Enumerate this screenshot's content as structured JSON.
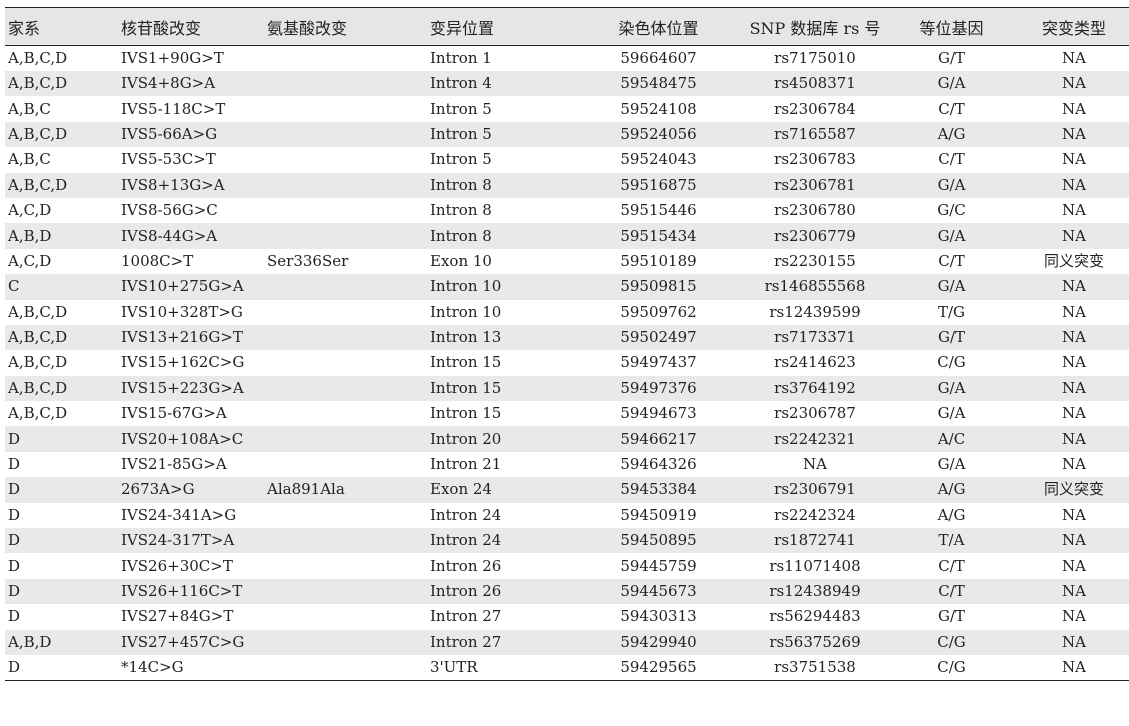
{
  "headers": [
    "家系",
    "核苷酸改变",
    "氨基酸改变",
    "变异位置",
    "染色体位置",
    "SNP 数据库 rs 号",
    "等位基因",
    "突变类型"
  ],
  "rows": [
    [
      "A,B,C,D",
      "IVS1+90G>T",
      "",
      "Intron 1",
      "59664607",
      "rs7175010",
      "G/T",
      "NA"
    ],
    [
      "A,B,C,D",
      "IVS4+8G>A",
      "",
      "Intron 4",
      "59548475",
      "rs4508371",
      "G/A",
      "NA"
    ],
    [
      "A,B,C",
      "IVS5-118C>T",
      "",
      "Intron 5",
      "59524108",
      "rs2306784",
      "C/T",
      "NA"
    ],
    [
      "A,B,C,D",
      "IVS5-66A>G",
      "",
      "Intron 5",
      "59524056",
      "rs7165587",
      "A/G",
      "NA"
    ],
    [
      "A,B,C",
      "IVS5-53C>T",
      "",
      "Intron 5",
      "59524043",
      "rs2306783",
      "C/T",
      "NA"
    ],
    [
      "A,B,C,D",
      "IVS8+13G>A",
      "",
      "Intron 8",
      "59516875",
      "rs2306781",
      "G/A",
      "NA"
    ],
    [
      "A,C,D",
      "IVS8-56G>C",
      "",
      "Intron 8",
      "59515446",
      "rs2306780",
      "G/C",
      "NA"
    ],
    [
      "A,B,D",
      "IVS8-44G>A",
      "",
      "Intron 8",
      "59515434",
      "rs2306779",
      "G/A",
      "NA"
    ],
    [
      "A,C,D",
      "1008C>T",
      "Ser336Ser",
      "Exon 10",
      "59510189",
      "rs2230155",
      "C/T",
      "同义突变"
    ],
    [
      "C",
      "IVS10+275G>A",
      "",
      "Intron 10",
      "59509815",
      "rs146855568",
      "G/A",
      "NA"
    ],
    [
      "A,B,C,D",
      "IVS10+328T>G",
      "",
      "Intron 10",
      "59509762",
      "rs12439599",
      "T/G",
      "NA"
    ],
    [
      "A,B,C,D",
      "IVS13+216G>T",
      "",
      "Intron 13",
      "59502497",
      "rs7173371",
      "G/T",
      "NA"
    ],
    [
      "A,B,C,D",
      "IVS15+162C>G",
      "",
      "Intron 15",
      "59497437",
      "rs2414623",
      "C/G",
      "NA"
    ],
    [
      "A,B,C,D",
      "IVS15+223G>A",
      "",
      "Intron 15",
      "59497376",
      "rs3764192",
      "G/A",
      "NA"
    ],
    [
      "A,B,C,D",
      "IVS15-67G>A",
      "",
      "Intron 15",
      "59494673",
      "rs2306787",
      "G/A",
      "NA"
    ],
    [
      "D",
      "IVS20+108A>C",
      "",
      "Intron 20",
      "59466217",
      "rs2242321",
      "A/C",
      "NA"
    ],
    [
      "D",
      "IVS21-85G>A",
      "",
      "Intron 21",
      "59464326",
      "NA",
      "G/A",
      "NA"
    ],
    [
      "D",
      "2673A>G",
      "Ala891Ala",
      "Exon 24",
      "59453384",
      "rs2306791",
      "A/G",
      "同义突变"
    ],
    [
      "D",
      "IVS24-341A>G",
      "",
      "Intron 24",
      "59450919",
      "rs2242324",
      "A/G",
      "NA"
    ],
    [
      "D",
      "IVS24-317T>A",
      "",
      "Intron 24",
      "59450895",
      "rs1872741",
      "T/A",
      "NA"
    ],
    [
      "D",
      "IVS26+30C>T",
      "",
      "Intron 26",
      "59445759",
      "rs11071408",
      "C/T",
      "NA"
    ],
    [
      "D",
      "IVS26+116C>T",
      "",
      "Intron 26",
      "59445673",
      "rs12438949",
      "C/T",
      "NA"
    ],
    [
      "D",
      "IVS27+84G>T",
      "",
      "Intron 27",
      "59430313",
      "rs56294483",
      "G/T",
      "NA"
    ],
    [
      "A,B,D",
      "IVS27+457C>G",
      "",
      "Intron 27",
      "59429940",
      "rs56375269",
      "C/G",
      "NA"
    ],
    [
      "D",
      "*14C>G",
      "",
      "3'UTR",
      "59429565",
      "rs3751538",
      "C/G",
      "NA"
    ]
  ]
}
